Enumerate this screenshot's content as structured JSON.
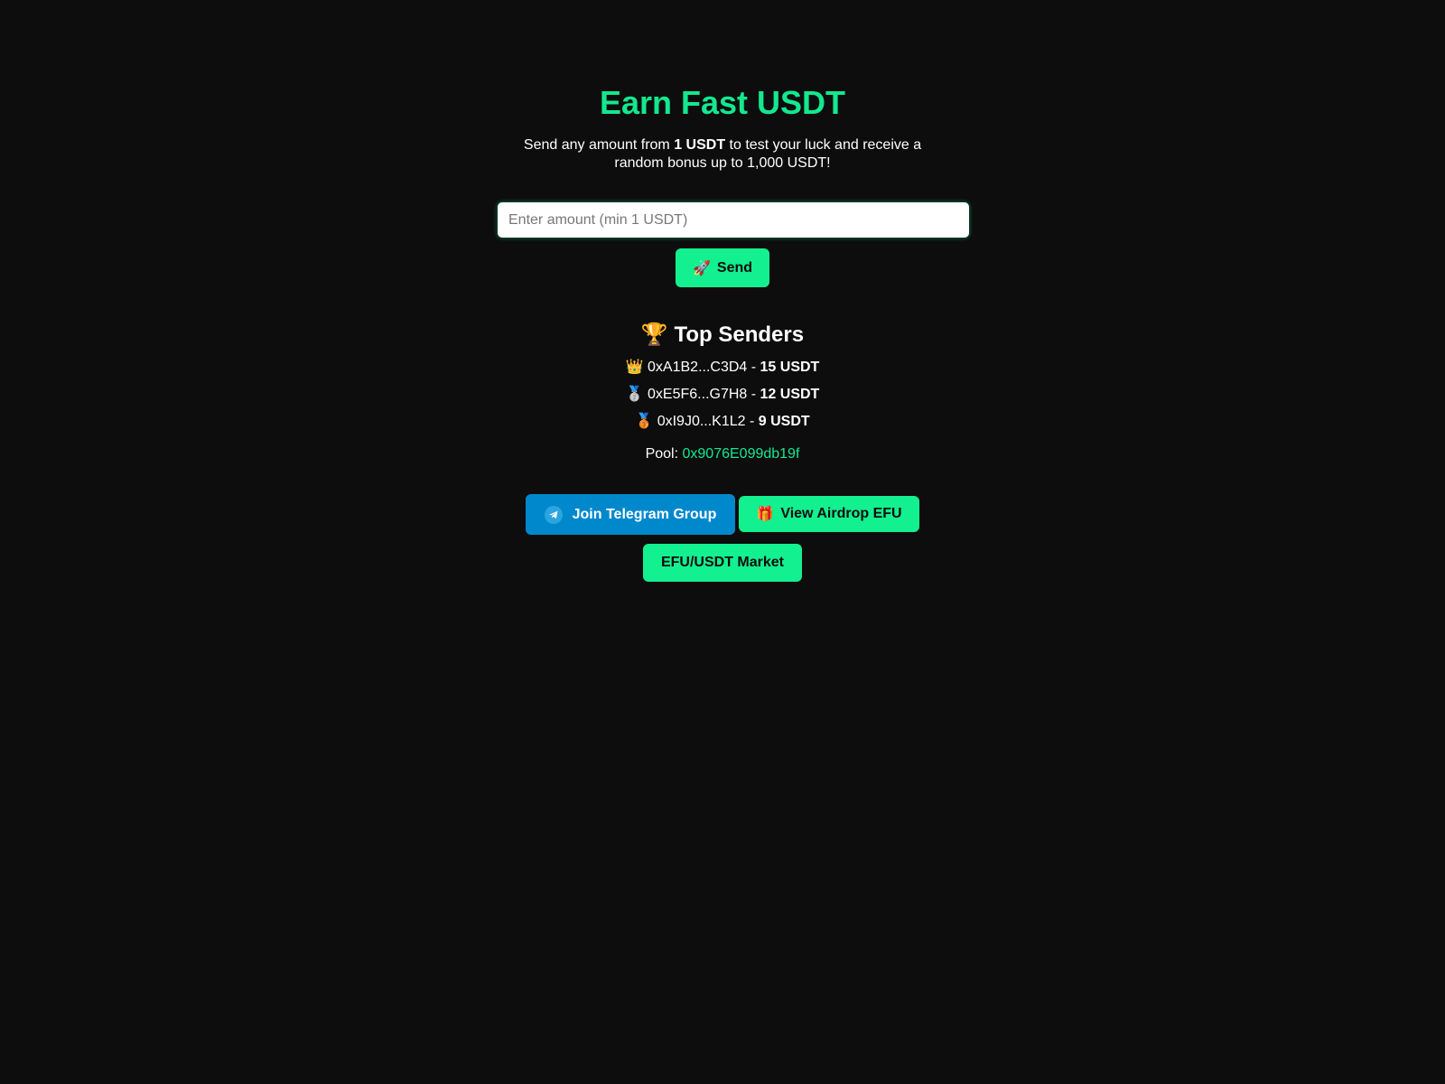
{
  "header": {
    "title": "Earn Fast USDT",
    "subtitle_part1": "Send any amount from ",
    "subtitle_bold": "1 USDT",
    "subtitle_part2": " to test your luck and receive a",
    "subtitle_line2": "random bonus up to 1,000 USDT!"
  },
  "form": {
    "amount_placeholder": "Enter amount (min 1 USDT)",
    "amount_value": "",
    "send_icon": "🚀",
    "send_label": "Send"
  },
  "leaderboard": {
    "title_icon": "🏆",
    "title": "Top Senders",
    "separator": " - ",
    "senders": [
      {
        "medal": "👑",
        "address": "0xA1B2...C3D4",
        "amount": "15 USDT"
      },
      {
        "medal": "🥈",
        "address": "0xE5F6...G7H8",
        "amount": "12 USDT"
      },
      {
        "medal": "🥉",
        "address": "0xI9J0...K1L2",
        "amount": "9 USDT"
      }
    ]
  },
  "pool": {
    "label": "Pool: ",
    "address": "0x9076E099db19f"
  },
  "links": {
    "telegram_icon": "telegram-icon",
    "telegram_label": "Join Telegram Group",
    "airdrop_icon": "🎁",
    "airdrop_label": "View Airdrop EFU",
    "market_label": "EFU/USDT Market"
  },
  "colors": {
    "background": "#0d0d0d",
    "accent": "#13f08f",
    "telegram": "#0088cc"
  }
}
